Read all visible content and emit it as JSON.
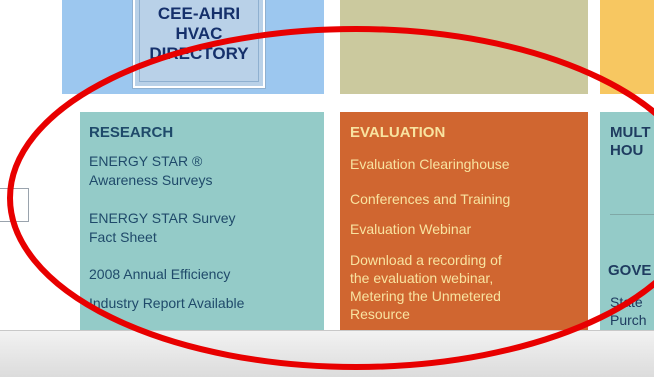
{
  "hvac_tile": {
    "lines": [
      "CEE-AHRI",
      "HVAC",
      "DIRECTORY"
    ]
  },
  "research": {
    "title": "RESEARCH",
    "links": [
      "ENERGY STAR ®",
      "Awareness Surveys",
      "ENERGY STAR Survey",
      "Fact Sheet",
      "2008 Annual Efficiency",
      "Industry Report Available"
    ]
  },
  "evaluation": {
    "title": "EVALUATION",
    "links": [
      "Evaluation Clearinghouse",
      "Conferences and Training",
      "Evaluation Webinar",
      "Download a recording of",
      "the evaluation webinar,",
      "Metering the Unmetered",
      "Resource"
    ]
  },
  "multi": {
    "title_lines": [
      "MULT",
      "HOU"
    ],
    "gov": "GOVE",
    "state_lines": [
      "State",
      "Purch"
    ]
  },
  "colors": {
    "annotation_red": "#e80000",
    "research_bg": "#94cbc8",
    "evaluation_bg": "#d06630",
    "hvac_bg": "#9cc7ef"
  }
}
